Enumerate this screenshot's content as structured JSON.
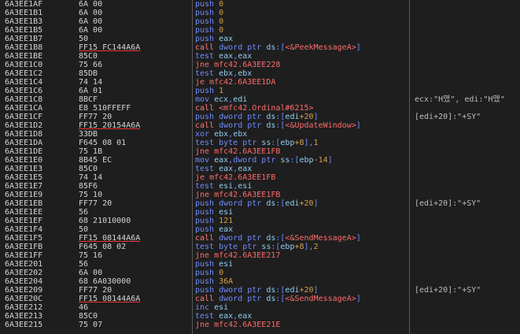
{
  "colors": {
    "background": "#1e1e1e",
    "mnemonic": "#6e8bff",
    "call_mnemonic": "#ff7c7c",
    "jump_mnemonic": "#ff6b6b",
    "immediate": "#d4a047",
    "register": "#8ecdf0",
    "symbol": "#ff6b6b"
  },
  "rows": [
    {
      "addr": "6A3EE1AF",
      "bytes": "6A 00",
      "dis": [
        {
          "t": "push ",
          "c": "m"
        },
        {
          "t": "0",
          "c": "i"
        }
      ],
      "cmt": ""
    },
    {
      "addr": "6A3EE1B1",
      "bytes": "6A 00",
      "dis": [
        {
          "t": "push ",
          "c": "m"
        },
        {
          "t": "0",
          "c": "i"
        }
      ],
      "cmt": ""
    },
    {
      "addr": "6A3EE1B3",
      "bytes": "6A 00",
      "dis": [
        {
          "t": "push ",
          "c": "m"
        },
        {
          "t": "0",
          "c": "i"
        }
      ],
      "cmt": ""
    },
    {
      "addr": "6A3EE1B5",
      "bytes": "6A 00",
      "dis": [
        {
          "t": "push ",
          "c": "m"
        },
        {
          "t": "0",
          "c": "i"
        }
      ],
      "cmt": ""
    },
    {
      "addr": "6A3EE1B7",
      "bytes": "50",
      "dis": [
        {
          "t": "push ",
          "c": "m"
        },
        {
          "t": "eax",
          "c": "r"
        }
      ],
      "cmt": ""
    },
    {
      "addr": "6A3EE1B8",
      "bytes": "FF15 FC144A6A",
      "ul": true,
      "dis": [
        {
          "t": "call ",
          "c": "c"
        },
        {
          "t": "dword ptr ",
          "c": "p"
        },
        {
          "t": "ds",
          "c": "r"
        },
        {
          "t": ":[",
          "c": "p"
        },
        {
          "t": "<&PeekMessageA>",
          "c": "s"
        },
        {
          "t": "]",
          "c": "p"
        }
      ],
      "cmt": ""
    },
    {
      "addr": "6A3EE1BE",
      "bytes": "85C0",
      "dis": [
        {
          "t": "test ",
          "c": "m"
        },
        {
          "t": "eax",
          "c": "r"
        },
        {
          "t": ",",
          "c": "p"
        },
        {
          "t": "eax",
          "c": "r"
        }
      ],
      "cmt": ""
    },
    {
      "addr": "6A3EE1C0",
      "bytes": "75 66",
      "dis": [
        {
          "t": "jne ",
          "c": "j"
        },
        {
          "t": "mfc42.6A3EE228",
          "c": "j"
        }
      ],
      "cmt": ""
    },
    {
      "addr": "6A3EE1C2",
      "bytes": "85DB",
      "dis": [
        {
          "t": "test ",
          "c": "m"
        },
        {
          "t": "ebx",
          "c": "r"
        },
        {
          "t": ",",
          "c": "p"
        },
        {
          "t": "ebx",
          "c": "r"
        }
      ],
      "cmt": ""
    },
    {
      "addr": "6A3EE1C4",
      "bytes": "74 14",
      "dis": [
        {
          "t": "je ",
          "c": "j"
        },
        {
          "t": "mfc42.6A3EE1DA",
          "c": "j"
        }
      ],
      "cmt": ""
    },
    {
      "addr": "6A3EE1C6",
      "bytes": "6A 01",
      "dis": [
        {
          "t": "push ",
          "c": "m"
        },
        {
          "t": "1",
          "c": "i"
        }
      ],
      "cmt": ""
    },
    {
      "addr": "6A3EE1C8",
      "bytes": "8BCF",
      "dis": [
        {
          "t": "mov ",
          "c": "m"
        },
        {
          "t": "ecx",
          "c": "r"
        },
        {
          "t": ",",
          "c": "p"
        },
        {
          "t": "edi",
          "c": "r"
        }
      ],
      "cmt": "ecx:\"H맸\", edi:\"H맸\""
    },
    {
      "addr": "6A3EE1CA",
      "bytes": "E8 510FFEFF",
      "dis": [
        {
          "t": "call ",
          "c": "c"
        },
        {
          "t": "<mfc42.Ordinal#6215>",
          "c": "s"
        }
      ],
      "cmt": ""
    },
    {
      "addr": "6A3EE1CF",
      "bytes": "FF77 20",
      "dis": [
        {
          "t": "push ",
          "c": "m"
        },
        {
          "t": "dword ptr ",
          "c": "p"
        },
        {
          "t": "ds",
          "c": "r"
        },
        {
          "t": ":[",
          "c": "p"
        },
        {
          "t": "edi",
          "c": "r"
        },
        {
          "t": "+20",
          "c": "i"
        },
        {
          "t": "]",
          "c": "p"
        }
      ],
      "cmt": "[edi+20]:\"+SY\""
    },
    {
      "addr": "6A3EE1D2",
      "bytes": "FF15 20154A6A",
      "ul": true,
      "dis": [
        {
          "t": "call ",
          "c": "c"
        },
        {
          "t": "dword ptr ",
          "c": "p"
        },
        {
          "t": "ds",
          "c": "r"
        },
        {
          "t": ":[",
          "c": "p"
        },
        {
          "t": "<&UpdateWindow>",
          "c": "s"
        },
        {
          "t": "]",
          "c": "p"
        }
      ],
      "cmt": ""
    },
    {
      "addr": "6A3EE1D8",
      "bytes": "33DB",
      "dis": [
        {
          "t": "xor ",
          "c": "m"
        },
        {
          "t": "ebx",
          "c": "r"
        },
        {
          "t": ",",
          "c": "p"
        },
        {
          "t": "ebx",
          "c": "r"
        }
      ],
      "cmt": ""
    },
    {
      "addr": "6A3EE1DA",
      "bytes": "F645 08 01",
      "dis": [
        {
          "t": "test ",
          "c": "m"
        },
        {
          "t": "byte ptr ",
          "c": "p"
        },
        {
          "t": "ss",
          "c": "r"
        },
        {
          "t": ":[",
          "c": "p"
        },
        {
          "t": "ebp",
          "c": "r"
        },
        {
          "t": "+8",
          "c": "i"
        },
        {
          "t": "],",
          "c": "p"
        },
        {
          "t": "1",
          "c": "i"
        }
      ],
      "cmt": ""
    },
    {
      "addr": "6A3EE1DE",
      "bytes": "75 1B",
      "dis": [
        {
          "t": "jne ",
          "c": "j"
        },
        {
          "t": "mfc42.6A3EE1FB",
          "c": "j"
        }
      ],
      "cmt": ""
    },
    {
      "addr": "6A3EE1E0",
      "bytes": "8B45 EC",
      "dis": [
        {
          "t": "mov ",
          "c": "m"
        },
        {
          "t": "eax",
          "c": "r"
        },
        {
          "t": ",dword ptr ",
          "c": "p"
        },
        {
          "t": "ss",
          "c": "r"
        },
        {
          "t": ":[",
          "c": "p"
        },
        {
          "t": "ebp",
          "c": "r"
        },
        {
          "t": "-14",
          "c": "i"
        },
        {
          "t": "]",
          "c": "p"
        }
      ],
      "cmt": ""
    },
    {
      "addr": "6A3EE1E3",
      "bytes": "85C0",
      "dis": [
        {
          "t": "test ",
          "c": "m"
        },
        {
          "t": "eax",
          "c": "r"
        },
        {
          "t": ",",
          "c": "p"
        },
        {
          "t": "eax",
          "c": "r"
        }
      ],
      "cmt": ""
    },
    {
      "addr": "6A3EE1E5",
      "bytes": "74 14",
      "dis": [
        {
          "t": "je ",
          "c": "j"
        },
        {
          "t": "mfc42.6A3EE1FB",
          "c": "j"
        }
      ],
      "cmt": ""
    },
    {
      "addr": "6A3EE1E7",
      "bytes": "85F6",
      "dis": [
        {
          "t": "test ",
          "c": "m"
        },
        {
          "t": "esi",
          "c": "r"
        },
        {
          "t": ",",
          "c": "p"
        },
        {
          "t": "esi",
          "c": "r"
        }
      ],
      "cmt": ""
    },
    {
      "addr": "6A3EE1E9",
      "bytes": "75 10",
      "dis": [
        {
          "t": "jne ",
          "c": "j"
        },
        {
          "t": "mfc42.6A3EE1FB",
          "c": "j"
        }
      ],
      "cmt": ""
    },
    {
      "addr": "6A3EE1EB",
      "bytes": "FF77 20",
      "dis": [
        {
          "t": "push ",
          "c": "m"
        },
        {
          "t": "dword ptr ",
          "c": "p"
        },
        {
          "t": "ds",
          "c": "r"
        },
        {
          "t": ":[",
          "c": "p"
        },
        {
          "t": "edi",
          "c": "r"
        },
        {
          "t": "+20",
          "c": "i"
        },
        {
          "t": "]",
          "c": "p"
        }
      ],
      "cmt": "[edi+20]:\"+SY\""
    },
    {
      "addr": "6A3EE1EE",
      "bytes": "56",
      "dis": [
        {
          "t": "push ",
          "c": "m"
        },
        {
          "t": "esi",
          "c": "r"
        }
      ],
      "cmt": ""
    },
    {
      "addr": "6A3EE1EF",
      "bytes": "68 21010000",
      "dis": [
        {
          "t": "push ",
          "c": "m"
        },
        {
          "t": "121",
          "c": "i"
        }
      ],
      "cmt": ""
    },
    {
      "addr": "6A3EE1F4",
      "bytes": "50",
      "dis": [
        {
          "t": "push ",
          "c": "m"
        },
        {
          "t": "eax",
          "c": "r"
        }
      ],
      "cmt": ""
    },
    {
      "addr": "6A3EE1F5",
      "bytes": "FF15 08144A6A",
      "ul": true,
      "dis": [
        {
          "t": "call ",
          "c": "c"
        },
        {
          "t": "dword ptr ",
          "c": "p"
        },
        {
          "t": "ds",
          "c": "r"
        },
        {
          "t": ":[",
          "c": "p"
        },
        {
          "t": "<&SendMessageA>",
          "c": "s"
        },
        {
          "t": "]",
          "c": "p"
        }
      ],
      "cmt": ""
    },
    {
      "addr": "6A3EE1FB",
      "bytes": "F645 08 02",
      "dis": [
        {
          "t": "test ",
          "c": "m"
        },
        {
          "t": "byte ptr ",
          "c": "p"
        },
        {
          "t": "ss",
          "c": "r"
        },
        {
          "t": ":[",
          "c": "p"
        },
        {
          "t": "ebp",
          "c": "r"
        },
        {
          "t": "+8",
          "c": "i"
        },
        {
          "t": "],",
          "c": "p"
        },
        {
          "t": "2",
          "c": "i"
        }
      ],
      "cmt": ""
    },
    {
      "addr": "6A3EE1FF",
      "bytes": "75 16",
      "dis": [
        {
          "t": "jne ",
          "c": "j"
        },
        {
          "t": "mfc42.6A3EE217",
          "c": "j"
        }
      ],
      "cmt": ""
    },
    {
      "addr": "6A3EE201",
      "bytes": "56",
      "dis": [
        {
          "t": "push ",
          "c": "m"
        },
        {
          "t": "esi",
          "c": "r"
        }
      ],
      "cmt": ""
    },
    {
      "addr": "6A3EE202",
      "bytes": "6A 00",
      "dis": [
        {
          "t": "push ",
          "c": "m"
        },
        {
          "t": "0",
          "c": "i"
        }
      ],
      "cmt": ""
    },
    {
      "addr": "6A3EE204",
      "bytes": "68 6A030000",
      "dis": [
        {
          "t": "push ",
          "c": "m"
        },
        {
          "t": "36A",
          "c": "i"
        }
      ],
      "cmt": ""
    },
    {
      "addr": "6A3EE209",
      "bytes": "FF77 20",
      "dis": [
        {
          "t": "push ",
          "c": "m"
        },
        {
          "t": "dword ptr ",
          "c": "p"
        },
        {
          "t": "ds",
          "c": "r"
        },
        {
          "t": ":[",
          "c": "p"
        },
        {
          "t": "edi",
          "c": "r"
        },
        {
          "t": "+20",
          "c": "i"
        },
        {
          "t": "]",
          "c": "p"
        }
      ],
      "cmt": "[edi+20]:\"+SY\""
    },
    {
      "addr": "6A3EE20C",
      "bytes": "FF15 08144A6A",
      "ul": true,
      "dis": [
        {
          "t": "call ",
          "c": "c"
        },
        {
          "t": "dword ptr ",
          "c": "p"
        },
        {
          "t": "ds",
          "c": "r"
        },
        {
          "t": ":[",
          "c": "p"
        },
        {
          "t": "<&SendMessageA>",
          "c": "s"
        },
        {
          "t": "]",
          "c": "p"
        }
      ],
      "cmt": ""
    },
    {
      "addr": "6A3EE212",
      "bytes": "46",
      "dis": [
        {
          "t": "inc ",
          "c": "m"
        },
        {
          "t": "esi",
          "c": "r"
        }
      ],
      "cmt": ""
    },
    {
      "addr": "6A3EE213",
      "bytes": "85C0",
      "dis": [
        {
          "t": "test ",
          "c": "m"
        },
        {
          "t": "eax",
          "c": "r"
        },
        {
          "t": ",",
          "c": "p"
        },
        {
          "t": "eax",
          "c": "r"
        }
      ],
      "cmt": ""
    },
    {
      "addr": "6A3EE215",
      "bytes": "75 07",
      "dis": [
        {
          "t": "jne ",
          "c": "j"
        },
        {
          "t": "mfc42.6A3EE21E",
          "c": "j"
        }
      ],
      "cmt": ""
    }
  ]
}
